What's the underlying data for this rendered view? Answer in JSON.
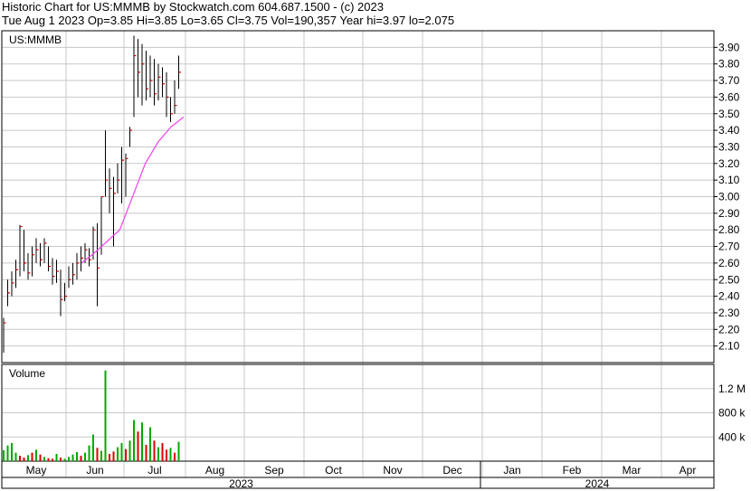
{
  "header": {
    "line1": "Historic Chart for US:MMMB by Stockwatch.com 604.687.1500 - (c) 2023",
    "line2": "Tue Aug  1 2023  Op=3.85  Hi=3.85  Lo=3.65  Cl=3.75  Vol=190,357  Year hi=3.97  lo=2.075"
  },
  "chart_data": {
    "type": "ohlc",
    "symbol_label": "US:MMMB",
    "price_axis": {
      "min": 2.0,
      "max": 4.0,
      "ticks": [
        "2.10",
        "2.20",
        "2.30",
        "2.40",
        "2.50",
        "2.60",
        "2.70",
        "2.80",
        "2.90",
        "3.00",
        "3.10",
        "3.20",
        "3.30",
        "3.40",
        "3.50",
        "3.60",
        "3.70",
        "3.80",
        "3.90"
      ]
    },
    "volume_label": "Volume",
    "volume_axis": {
      "max": 1600000,
      "ticks": [
        {
          "v": 400000,
          "t": "400 k"
        },
        {
          "v": 800000,
          "t": "800 k"
        },
        {
          "v": 1200000,
          "t": "1.2 M"
        }
      ]
    },
    "months": [
      "May",
      "Jun",
      "Jul",
      "Aug",
      "Sep",
      "Oct",
      "Nov",
      "Dec",
      "Jan",
      "Feb",
      "Mar",
      "Apr"
    ],
    "years": [
      "2023",
      "2024"
    ],
    "colors": {
      "up": "#00aa00",
      "down": "#dd0000",
      "bar": "#000000",
      "ma": "#ee44ee",
      "grid": "#c8c8c8"
    },
    "bars": [
      {
        "h": 2.27,
        "l": 2.06,
        "c": 2.24
      },
      {
        "h": 2.5,
        "l": 2.34,
        "c": 2.42
      },
      {
        "h": 2.55,
        "l": 2.4,
        "c": 2.48
      },
      {
        "h": 2.62,
        "l": 2.45,
        "c": 2.56
      },
      {
        "h": 2.83,
        "l": 2.52,
        "c": 2.82
      },
      {
        "h": 2.8,
        "l": 2.55,
        "c": 2.6
      },
      {
        "h": 2.66,
        "l": 2.5,
        "c": 2.54
      },
      {
        "h": 2.7,
        "l": 2.52,
        "c": 2.65
      },
      {
        "h": 2.75,
        "l": 2.6,
        "c": 2.68
      },
      {
        "h": 2.72,
        "l": 2.58,
        "c": 2.62
      },
      {
        "h": 2.75,
        "l": 2.6,
        "c": 2.72
      },
      {
        "h": 2.7,
        "l": 2.55,
        "c": 2.58
      },
      {
        "h": 2.63,
        "l": 2.47,
        "c": 2.52
      },
      {
        "h": 2.62,
        "l": 2.48,
        "c": 2.55
      },
      {
        "h": 2.56,
        "l": 2.28,
        "c": 2.38
      },
      {
        "h": 2.48,
        "l": 2.37,
        "c": 2.4
      },
      {
        "h": 2.58,
        "l": 2.45,
        "c": 2.5
      },
      {
        "h": 2.6,
        "l": 2.47,
        "c": 2.53
      },
      {
        "h": 2.66,
        "l": 2.5,
        "c": 2.6
      },
      {
        "h": 2.7,
        "l": 2.55,
        "c": 2.63
      },
      {
        "h": 2.72,
        "l": 2.6,
        "c": 2.68
      },
      {
        "h": 2.69,
        "l": 2.58,
        "c": 2.62
      },
      {
        "h": 2.82,
        "l": 2.62,
        "c": 2.8
      },
      {
        "h": 2.84,
        "l": 2.34,
        "c": 2.57
      },
      {
        "h": 3.0,
        "l": 2.65,
        "c": 3.0
      },
      {
        "h": 3.4,
        "l": 3.0,
        "c": 3.1
      },
      {
        "h": 3.17,
        "l": 2.9,
        "c": 3.05
      },
      {
        "h": 3.12,
        "l": 2.7,
        "c": 3.02
      },
      {
        "h": 3.2,
        "l": 3.02,
        "c": 3.1
      },
      {
        "h": 3.3,
        "l": 2.96,
        "c": 3.22
      },
      {
        "h": 3.26,
        "l": 3.0,
        "c": 3.23
      },
      {
        "h": 3.42,
        "l": 3.3,
        "c": 3.4
      },
      {
        "h": 3.97,
        "l": 3.48,
        "c": 3.85
      },
      {
        "h": 3.95,
        "l": 3.6,
        "c": 3.75
      },
      {
        "h": 3.92,
        "l": 3.55,
        "c": 3.8
      },
      {
        "h": 3.88,
        "l": 3.58,
        "c": 3.65
      },
      {
        "h": 3.85,
        "l": 3.6,
        "c": 3.7
      },
      {
        "h": 3.83,
        "l": 3.55,
        "c": 3.62
      },
      {
        "h": 3.8,
        "l": 3.58,
        "c": 3.72
      },
      {
        "h": 3.78,
        "l": 3.6,
        "c": 3.68
      },
      {
        "h": 3.75,
        "l": 3.48,
        "c": 3.6
      },
      {
        "h": 3.6,
        "l": 3.45,
        "c": 3.5
      },
      {
        "h": 3.7,
        "l": 3.5,
        "c": 3.55
      },
      {
        "h": 3.85,
        "l": 3.65,
        "c": 3.75
      }
    ],
    "volumes": [
      {
        "v": 180000,
        "up": true
      },
      {
        "v": 260000,
        "up": true
      },
      {
        "v": 300000,
        "up": true
      },
      {
        "v": 140000,
        "up": true
      },
      {
        "v": 90000,
        "up": false
      },
      {
        "v": 60000,
        "up": false
      },
      {
        "v": 100000,
        "up": true
      },
      {
        "v": 140000,
        "up": false
      },
      {
        "v": 190000,
        "up": true
      },
      {
        "v": 110000,
        "up": false
      },
      {
        "v": 70000,
        "up": true
      },
      {
        "v": 50000,
        "up": false
      },
      {
        "v": 40000,
        "up": false
      },
      {
        "v": 120000,
        "up": true
      },
      {
        "v": 60000,
        "up": false
      },
      {
        "v": 40000,
        "up": true
      },
      {
        "v": 70000,
        "up": true
      },
      {
        "v": 110000,
        "up": true
      },
      {
        "v": 150000,
        "up": true
      },
      {
        "v": 90000,
        "up": false
      },
      {
        "v": 140000,
        "up": true
      },
      {
        "v": 260000,
        "up": true
      },
      {
        "v": 440000,
        "up": true
      },
      {
        "v": 220000,
        "up": false
      },
      {
        "v": 170000,
        "up": true
      },
      {
        "v": 1500000,
        "up": true
      },
      {
        "v": 120000,
        "up": false
      },
      {
        "v": 160000,
        "up": false
      },
      {
        "v": 230000,
        "up": true
      },
      {
        "v": 300000,
        "up": true
      },
      {
        "v": 200000,
        "up": false
      },
      {
        "v": 340000,
        "up": true
      },
      {
        "v": 680000,
        "up": true
      },
      {
        "v": 490000,
        "up": false
      },
      {
        "v": 640000,
        "up": true
      },
      {
        "v": 270000,
        "up": false
      },
      {
        "v": 560000,
        "up": true
      },
      {
        "v": 340000,
        "up": false
      },
      {
        "v": 230000,
        "up": true
      },
      {
        "v": 300000,
        "up": false
      },
      {
        "v": 190000,
        "up": false
      },
      {
        "v": 220000,
        "up": true
      },
      {
        "v": 140000,
        "up": false
      },
      {
        "v": 320000,
        "up": true
      }
    ],
    "moving_average": [
      2.6,
      2.66,
      2.73,
      2.8,
      3.0,
      3.2,
      3.33,
      3.42,
      3.48
    ]
  }
}
